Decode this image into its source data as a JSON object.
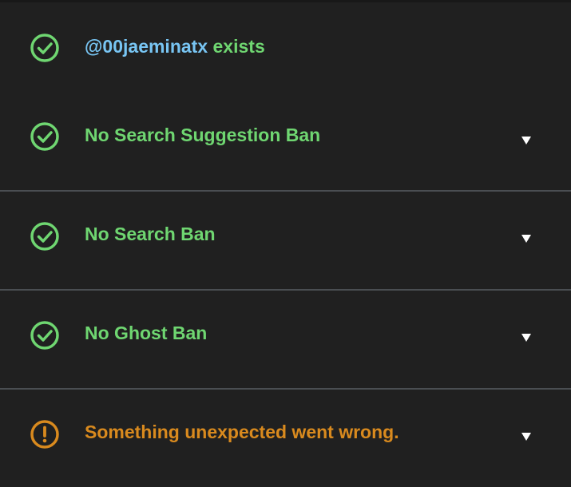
{
  "colors": {
    "background": "#202020",
    "success": "#6fd671",
    "warning": "#d98a1e",
    "handle": "#78c5f3",
    "divider": "#4a4e52"
  },
  "checks": [
    {
      "icon": "check-circle-icon",
      "status": "success",
      "handle": "@00jaeminatx",
      "label": " exists",
      "expandable": false
    },
    {
      "icon": "check-circle-icon",
      "status": "success",
      "label": "No Search Suggestion Ban",
      "expandable": true,
      "expand_icon": "caret-down-icon"
    },
    {
      "icon": "check-circle-icon",
      "status": "success",
      "label": "No Search Ban",
      "expandable": true,
      "expand_icon": "caret-down-icon"
    },
    {
      "icon": "check-circle-icon",
      "status": "success",
      "label": "No Ghost Ban",
      "expandable": true,
      "expand_icon": "caret-down-icon"
    },
    {
      "icon": "exclamation-circle-icon",
      "status": "warning",
      "label": "Something unexpected went wrong.",
      "expandable": true,
      "expand_icon": "caret-down-icon"
    }
  ]
}
